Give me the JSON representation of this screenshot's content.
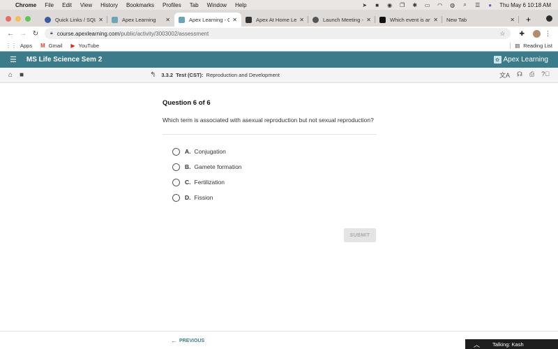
{
  "menubar": {
    "app": "Chrome",
    "items": [
      "File",
      "Edit",
      "View",
      "History",
      "Bookmarks",
      "Profiles",
      "Tab",
      "Window",
      "Help"
    ],
    "datetime": "Thu May 6  10:18 AM"
  },
  "tabs": [
    {
      "label": "Quick Links / SQL",
      "icon": "globe-icon",
      "active": false
    },
    {
      "label": "Apex Learning",
      "icon": "apex-icon",
      "active": false
    },
    {
      "label": "Apex Learning - Co",
      "icon": "apex-icon",
      "active": true
    },
    {
      "label": "Apex At Home Lear",
      "icon": "portrait-icon",
      "active": false
    },
    {
      "label": "Launch Meeting - Z",
      "icon": "globe-icon",
      "active": false
    },
    {
      "label": "Which event is an e",
      "icon": "brainly-icon",
      "active": false
    },
    {
      "label": "New Tab",
      "icon": "",
      "active": false
    }
  ],
  "address": {
    "host": "course.apexlearning.com",
    "path": "/public/activity/3003002/assessment"
  },
  "bookmarks": {
    "items": [
      {
        "label": "Apps",
        "icon": "apps-grid-icon"
      },
      {
        "label": "Gmail",
        "icon": "gmail-icon"
      },
      {
        "label": "YouTube",
        "icon": "youtube-icon"
      }
    ],
    "reading_list": "Reading List"
  },
  "app": {
    "course_title": "MS Life Science Sem 2",
    "brand": "Apex Learning",
    "brand_color": "#3b7b8a",
    "breadcrumb": {
      "number": "3.3.2",
      "type": "Test (CST):",
      "title": "Reproduction and Development"
    }
  },
  "question": {
    "header": "Question 6 of 6",
    "text": "Which term is associated with asexual reproduction but not sexual reproduction?",
    "options": [
      {
        "letter": "A.",
        "text": "Conjugation"
      },
      {
        "letter": "B.",
        "text": "Gamete formation"
      },
      {
        "letter": "C.",
        "text": "Fertilization"
      },
      {
        "letter": "D.",
        "text": "Fission"
      }
    ],
    "selected": null,
    "submit_label": "SUBMIT"
  },
  "footer": {
    "previous_label": "PREVIOUS"
  },
  "zoom_overlay": {
    "label": "Talking: Kash"
  }
}
